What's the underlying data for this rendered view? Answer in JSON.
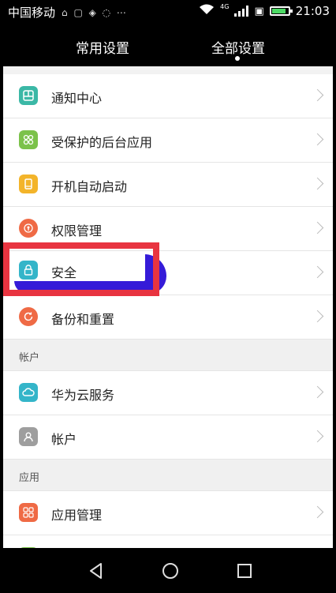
{
  "status_bar": {
    "carrier": "中国移动",
    "time": "21:03",
    "network": "4G"
  },
  "tabs": [
    {
      "label": "常用设置"
    },
    {
      "label": "全部设置",
      "selected": true
    }
  ],
  "items": [
    {
      "label": "通知中心",
      "icon": "notification-icon",
      "color": "#3bb8a6"
    },
    {
      "label": "受保护的后台应用",
      "icon": "protected-apps-icon",
      "color": "#7bc24a"
    },
    {
      "label": "开机自动启动",
      "icon": "autostart-icon",
      "color": "#f3b42a"
    },
    {
      "label": "权限管理",
      "icon": "permission-icon",
      "color": "#ef6a45"
    },
    {
      "label": "安全",
      "icon": "lock-icon",
      "color": "#34b5c9"
    },
    {
      "label": "备份和重置",
      "icon": "backup-icon",
      "color": "#ef6a45"
    }
  ],
  "account_section": {
    "header": "帐户",
    "items": [
      {
        "label": "华为云服务",
        "icon": "cloud-icon",
        "color": "#34b5c9"
      },
      {
        "label": "帐户",
        "icon": "account-icon",
        "color": "#9e9e9e"
      }
    ]
  },
  "apps_section": {
    "header": "应用",
    "items": [
      {
        "label": "应用管理",
        "icon": "apps-icon",
        "color": "#ef6a45"
      }
    ]
  },
  "colors": {
    "highlight_box": "#e83440",
    "scribble": "#2a0fd6"
  }
}
